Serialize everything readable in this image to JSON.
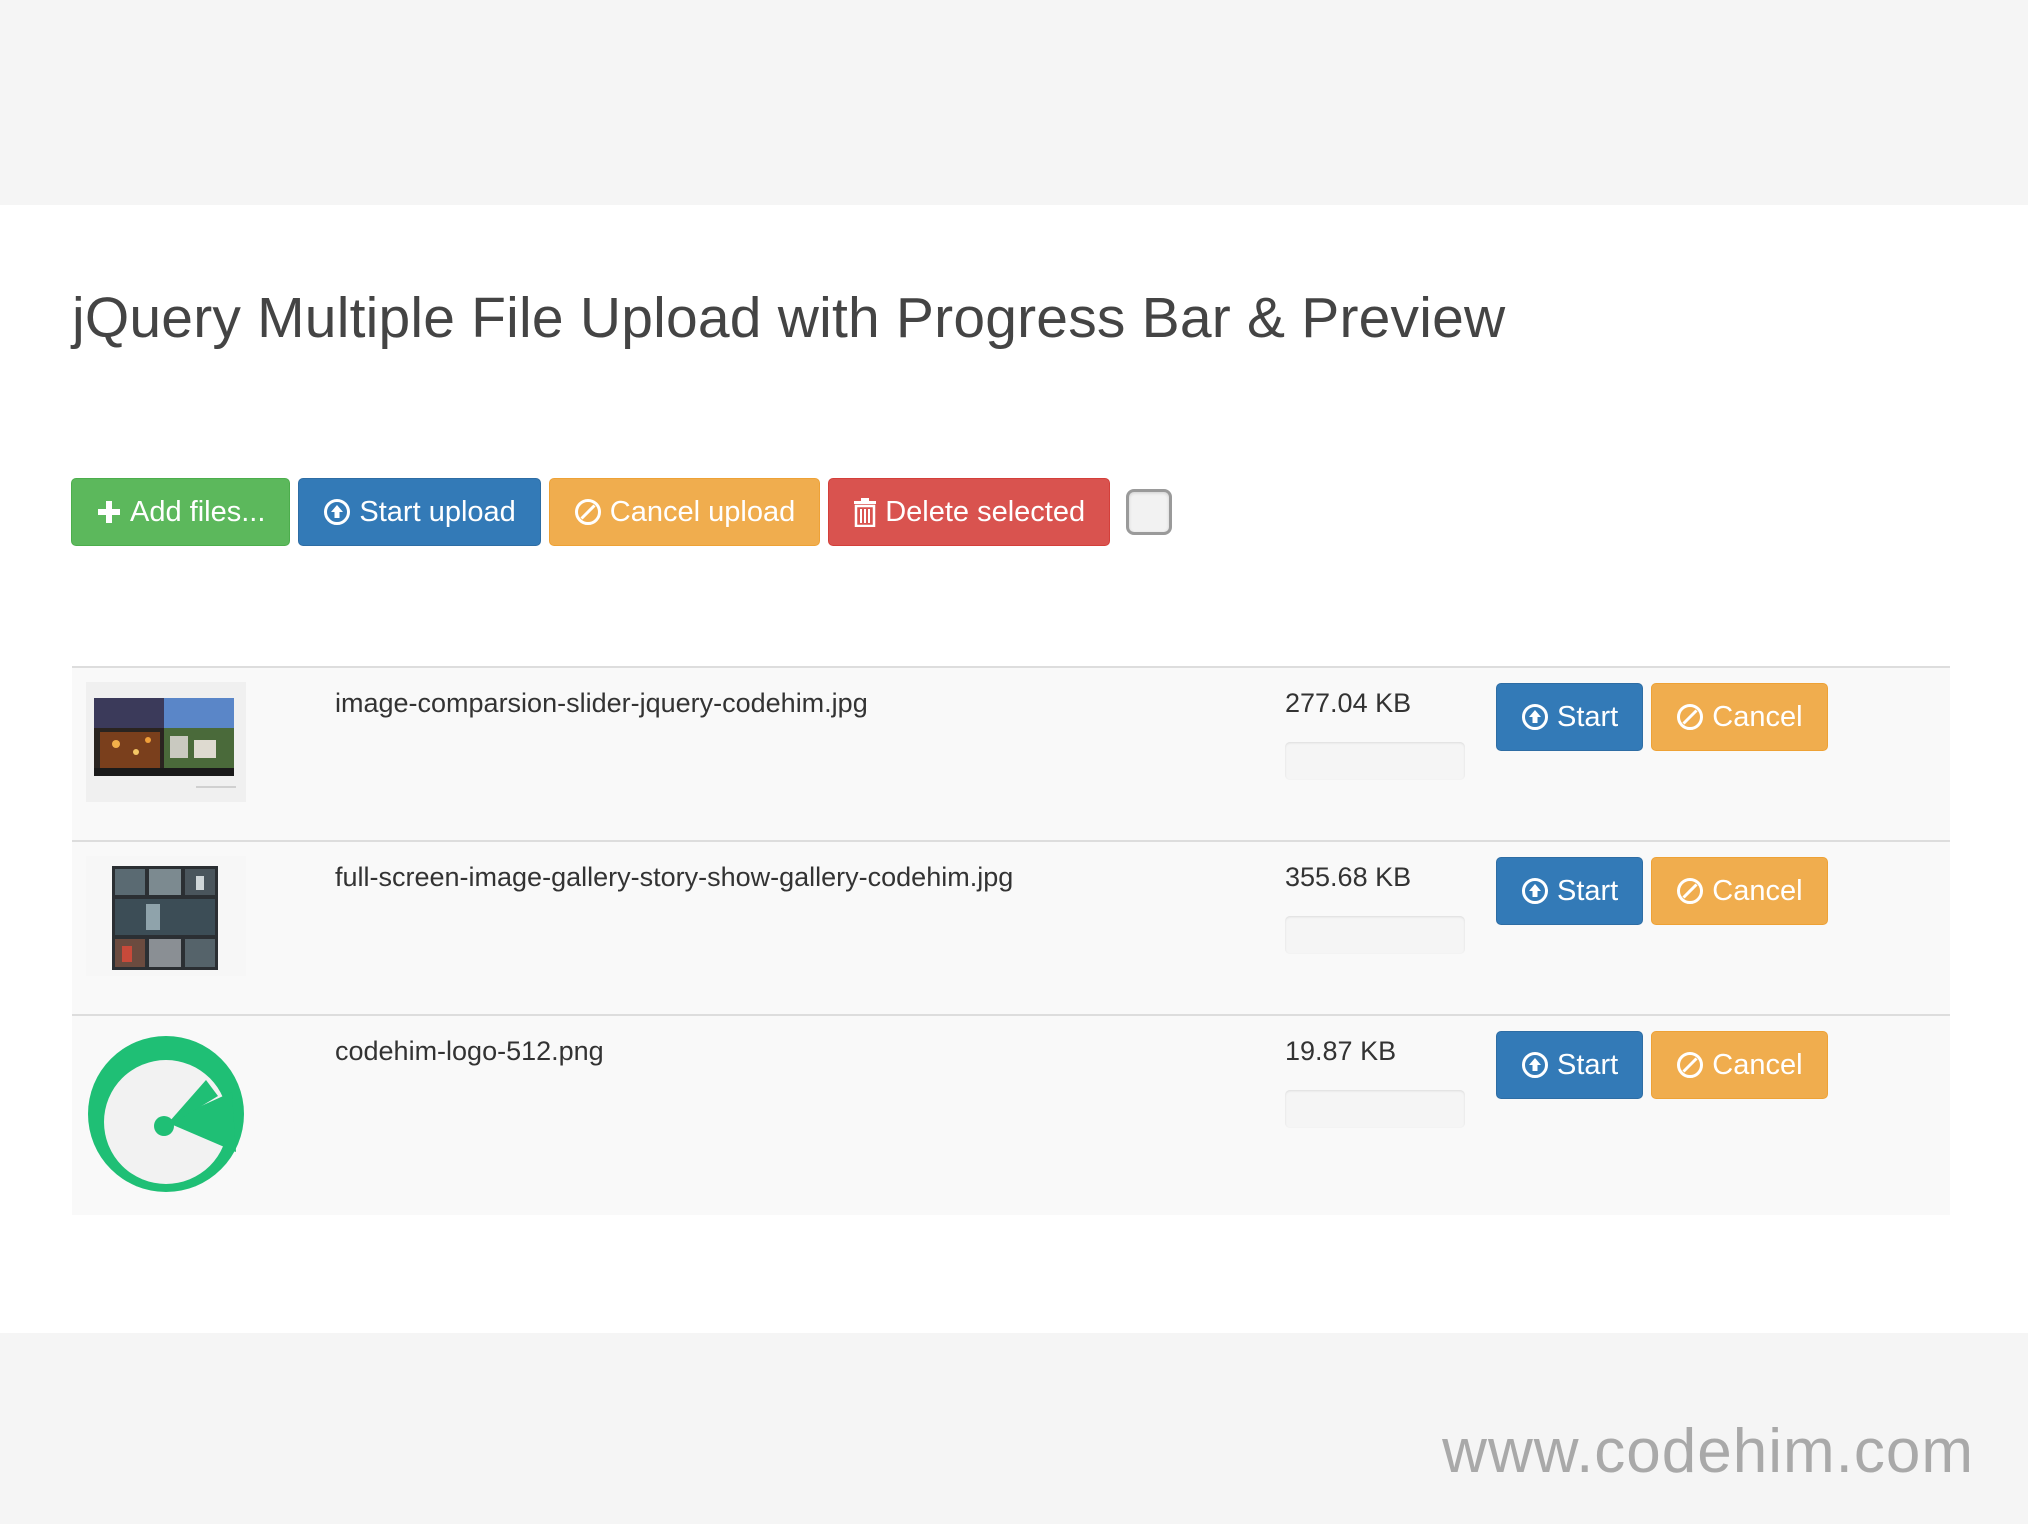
{
  "page": {
    "title": "jQuery Multiple File Upload with Progress Bar & Preview",
    "watermark": "www.codehim.com"
  },
  "toolbar": {
    "add_files_label": "Add files...",
    "start_upload_label": "Start upload",
    "cancel_upload_label": "Cancel upload",
    "delete_selected_label": "Delete selected",
    "select_all_checked": false
  },
  "files": [
    {
      "name": "image-comparsion-slider-jquery-codehim.jpg",
      "size": "277.04 KB",
      "progress": 0,
      "start_label": "Start",
      "cancel_label": "Cancel",
      "thumb_icon": "city-photo-thumbnail"
    },
    {
      "name": "full-screen-image-gallery-story-show-gallery-codehim.jpg",
      "size": "355.68 KB",
      "progress": 0,
      "start_label": "Start",
      "cancel_label": "Cancel",
      "thumb_icon": "gallery-grid-thumbnail"
    },
    {
      "name": "codehim-logo-512.png",
      "size": "19.87 KB",
      "progress": 0,
      "start_label": "Start",
      "cancel_label": "Cancel",
      "thumb_icon": "codehim-logo-thumbnail"
    }
  ],
  "colors": {
    "success": "#5cb85c",
    "primary": "#337ab7",
    "warning": "#f0ad4e",
    "danger": "#d9534f",
    "logo_green": "#1fbf75"
  }
}
